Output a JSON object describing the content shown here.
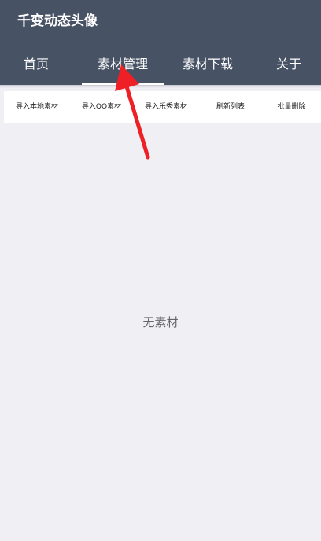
{
  "app": {
    "title": "千变动态头像"
  },
  "tabs": [
    {
      "label": "首页"
    },
    {
      "label": "素材管理"
    },
    {
      "label": "素材下载"
    },
    {
      "label": "关于"
    }
  ],
  "toolbar": {
    "import_local": "导入本地素材",
    "import_qq": "导入QQ素材",
    "import_lexiu": "导入乐秀素材",
    "refresh": "刷新列表",
    "batch_delete": "批量删除"
  },
  "content": {
    "empty_text": "无素材"
  },
  "colors": {
    "appbar": "#475264",
    "background": "#efeff4",
    "arrow": "#ee1f25"
  },
  "icons": {
    "annotation": "red-arrow-icon"
  }
}
